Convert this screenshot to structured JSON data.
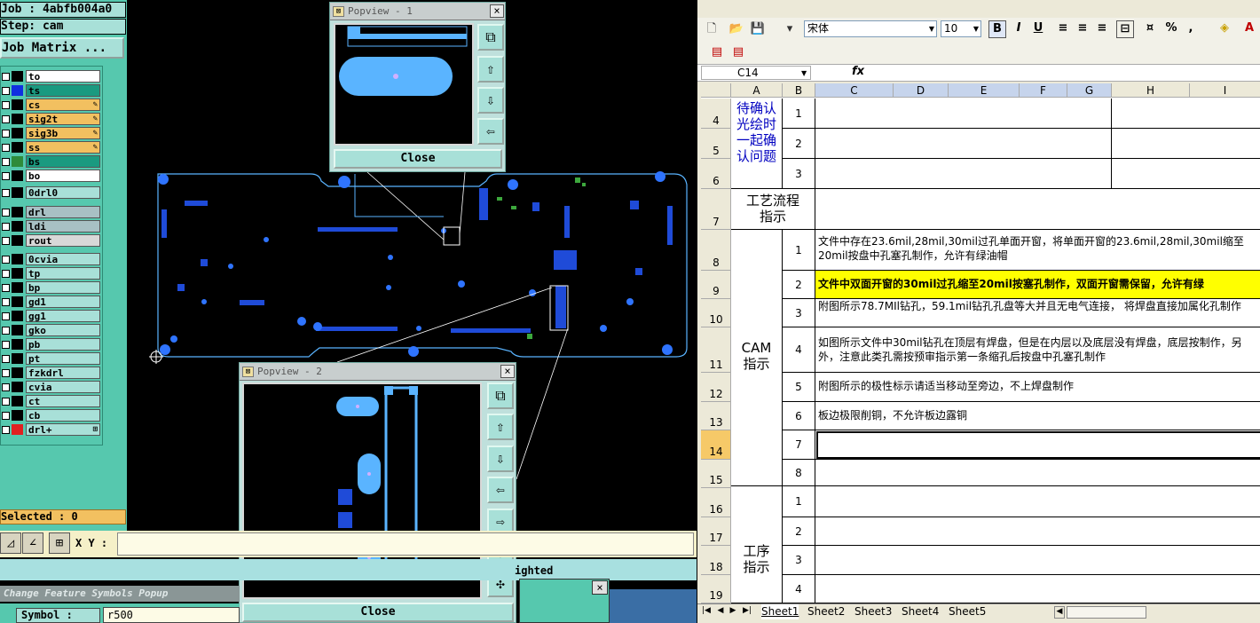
{
  "cam": {
    "job_line": "Job : 4abfb004a0",
    "step_line": "Step: cam",
    "job_matrix": "Job Matrix ...",
    "layers": [
      {
        "name": "to",
        "color": "#ffffff",
        "swatch": "#000000"
      },
      {
        "name": "ts",
        "color": "#1a9a80",
        "swatch": "#1030e0"
      },
      {
        "name": "cs",
        "color": "#f2c060",
        "swatch": "#000000",
        "wr": true
      },
      {
        "name": "sig2t",
        "color": "#f2c060",
        "swatch": "#000000",
        "wr": true
      },
      {
        "name": "sig3b",
        "color": "#f2c060",
        "swatch": "#000000",
        "wr": true
      },
      {
        "name": "ss",
        "color": "#f2c060",
        "swatch": "#000000",
        "wr": true
      },
      {
        "name": "bs",
        "color": "#1a9a80",
        "swatch": "#2e8b3a"
      },
      {
        "name": "bo",
        "color": "#ffffff",
        "swatch": "#000000"
      },
      {
        "name": "0drl0",
        "color": "#a8e0d8",
        "swatch": "#000000"
      },
      {
        "name": "drl",
        "color": "#a8c0c4",
        "swatch": "#000000"
      },
      {
        "name": "ldi",
        "color": "#a8c0c4",
        "swatch": "#000000"
      },
      {
        "name": "rout",
        "color": "#d8d8d8",
        "swatch": "#000000"
      },
      {
        "name": "0cvia",
        "color": "#a8e0d8",
        "swatch": "#000000"
      },
      {
        "name": "tp",
        "color": "#a8e0d8",
        "swatch": "#000000"
      },
      {
        "name": "bp",
        "color": "#a8e0d8",
        "swatch": "#000000"
      },
      {
        "name": "gd1",
        "color": "#a8e0d8",
        "swatch": "#000000"
      },
      {
        "name": "gg1",
        "color": "#a8e0d8",
        "swatch": "#000000"
      },
      {
        "name": "gko",
        "color": "#a8e0d8",
        "swatch": "#000000"
      },
      {
        "name": "pb",
        "color": "#a8e0d8",
        "swatch": "#000000"
      },
      {
        "name": "pt",
        "color": "#a8e0d8",
        "swatch": "#000000"
      },
      {
        "name": "fzkdrl",
        "color": "#a8e0d8",
        "swatch": "#000000"
      },
      {
        "name": "cvia",
        "color": "#a8e0d8",
        "swatch": "#000000"
      },
      {
        "name": "ct",
        "color": "#a8e0d8",
        "swatch": "#000000"
      },
      {
        "name": "cb",
        "color": "#a8e0d8",
        "swatch": "#000000"
      },
      {
        "name": "drl+",
        "color": "#a8e0d8",
        "swatch": "#e02020",
        "wr2": true
      }
    ],
    "selected": "Selected : 0",
    "xy_label": "X Y :",
    "highlighted_text": "ighted",
    "change_feature_title": "Change Feature Symbols Popup",
    "symbol_label": "Symbol :",
    "symbol_value": "r500",
    "popview1": {
      "title": "Popview - 1",
      "close": "Close"
    },
    "popview2": {
      "title": "Popview - 2",
      "close": "Close"
    }
  },
  "excel": {
    "font_name": "宋体",
    "font_size": "10",
    "cell_ref": "C14",
    "fx": "fx",
    "columns": [
      "A",
      "B",
      "C",
      "D",
      "E",
      "F",
      "G",
      "H",
      "I"
    ],
    "sections": {
      "confirm": "待确认光绘时一起确认问题",
      "process": "工艺流程指示",
      "cam": "CAM指示",
      "procedure": "工序指示"
    },
    "row_numbers": [
      "4",
      "5",
      "6",
      "7",
      "8",
      "9",
      "10",
      "11",
      "12",
      "13",
      "14",
      "15",
      "16",
      "17",
      "18",
      "19"
    ],
    "confirm_items": [
      "1",
      "2",
      "3"
    ],
    "cam_items": [
      {
        "no": "1",
        "text": "文件中存在23.6mil,28mil,30mil过孔单面开窗，将单面开窗的23.6mil,28mil,30mil缩至20mil按盘中孔塞孔制作，允许有绿油帽"
      },
      {
        "no": "2",
        "text": "文件中双面开窗的30mil过孔缩至20mil按塞孔制作，双面开窗需保留，允许有绿"
      },
      {
        "no": "3",
        "text": "附图所示78.7MIl钻孔，59.1mil钻孔孔盘等大并且无电气连接， 将焊盘直接加属化孔制作"
      },
      {
        "no": "4",
        "text": "如图所示文件中30mil钻孔在顶层有焊盘，但是在内层以及底层没有焊盘，底层按制作，另外，注意此类孔需按预审指示第一条缩孔后按盘中孔塞孔制作"
      },
      {
        "no": "5",
        "text": "附图所示的极性标示请适当移动至旁边，不上焊盘制作"
      },
      {
        "no": "6",
        "text": "板边极限削铜，不允许板边露铜"
      },
      {
        "no": "7",
        "text": ""
      },
      {
        "no": "8",
        "text": ""
      }
    ],
    "procedure_items": [
      "1",
      "2",
      "3",
      "4"
    ],
    "sheets": [
      "Sheet1",
      "Sheet2",
      "Sheet3",
      "Sheet4",
      "Sheet5"
    ]
  }
}
